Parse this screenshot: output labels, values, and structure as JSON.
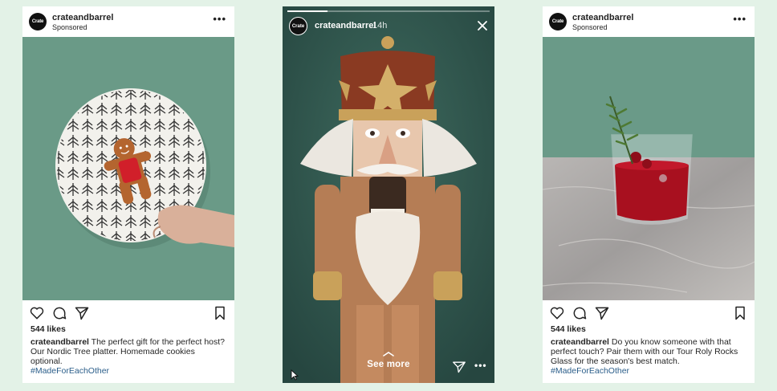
{
  "brand_logo_text": "Crate",
  "posts": {
    "left": {
      "username": "crateandbarrel",
      "sponsored": "Sponsored",
      "likes": "544 likes",
      "caption_user": "crateandbarrel",
      "caption_text": " The perfect gift for the perfect host? Our Nordic Tree platter. Homemade cookies optional.",
      "hashtag": "#MadeForEachOther"
    },
    "right": {
      "username": "crateandbarrel",
      "sponsored": "Sponsored",
      "likes": "544 likes",
      "caption_user": "crateandbarrel",
      "caption_text": " Do you know someone with that perfect touch? Pair them with our Tour Roly Rocks Glass for the season's best match.",
      "hashtag": "#MadeForEachOther"
    }
  },
  "story": {
    "username": "crateandbarrel",
    "time": "14h",
    "progress_fraction": 0.2,
    "see_more": "See more"
  },
  "icons": [
    "heart-icon",
    "comment-icon",
    "share-icon",
    "bookmark-icon",
    "more-icon",
    "close-icon",
    "chevron-up-icon",
    "cursor-icon"
  ],
  "colors": {
    "page_background": "#e3f2e7",
    "hashtag": "#2b5e8a",
    "story_background": "#2e5048"
  }
}
